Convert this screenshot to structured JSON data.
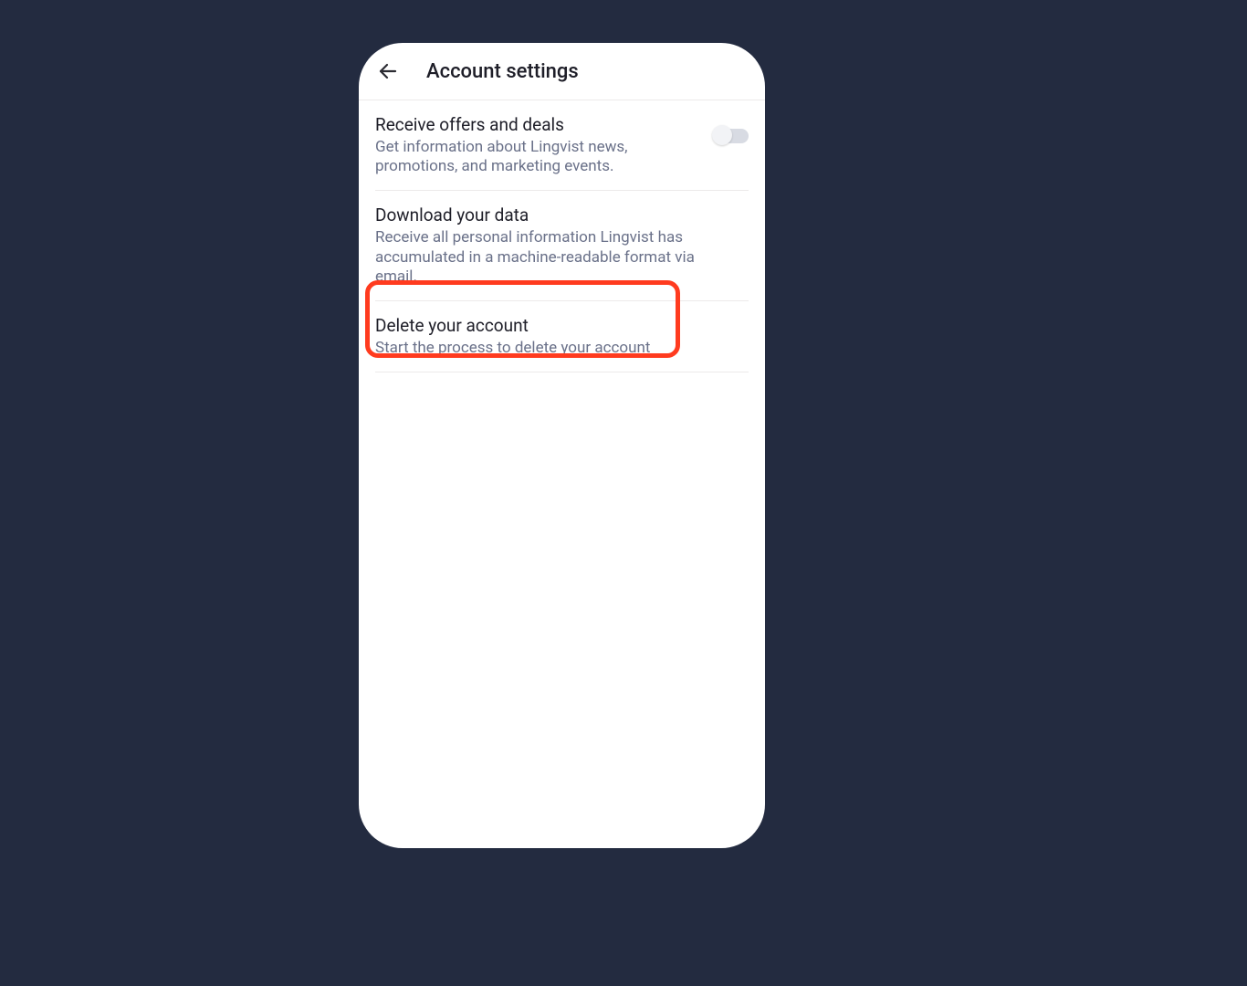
{
  "header": {
    "title": "Account settings"
  },
  "settings": {
    "offers": {
      "title": "Receive offers and deals",
      "desc": "Get information about Lingvist news, promotions, and marketing events.",
      "toggled": false
    },
    "download": {
      "title": "Download your data",
      "desc": "Receive all personal information Lingvist has accumulated in a machine-readable format via email."
    },
    "delete": {
      "title": "Delete your account",
      "desc": "Start the process to delete your account"
    }
  }
}
